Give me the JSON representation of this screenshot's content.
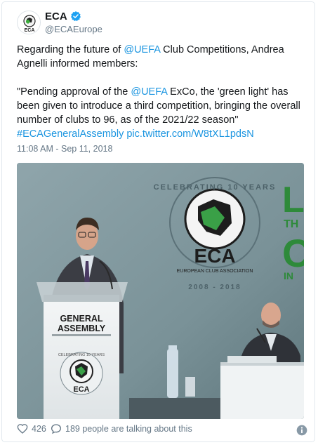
{
  "author": {
    "display_name": "ECA",
    "handle": "@ECAEurope",
    "avatar_label": "ECA"
  },
  "tweet": {
    "line1_pre": "Regarding the future of ",
    "line1_mention": "@UEFA",
    "line1_post": " Club Competitions, Andrea Agnelli informed members:",
    "quote_pre": "\"Pending approval of the ",
    "quote_mention": "@UEFA",
    "quote_post": " ExCo, the 'green light' has been given to introduce a third competition, bringing the overall number of clubs to 96, as of the 2021/22 season\"",
    "hashtag": "#ECAGeneralAssembly",
    "media_link": "pic.twitter.com/W8tXL1pdsN",
    "timestamp": "11:08 AM - Sep 11, 2018"
  },
  "photo": {
    "banner_arc": "CELEBRATING 10 YEARS",
    "banner_name": "ECA",
    "banner_sub": "EUROPEAN CLUB ASSOCIATION",
    "banner_years": "2008 - 2018",
    "podium_title1": "GENERAL",
    "podium_title2": "ASSEMBLY",
    "podium_arc": "CELEBRATING 10 YEARS",
    "podium_name": "ECA",
    "right_letters": "L\nTH\nC\nIN"
  },
  "engagement": {
    "likes": "426",
    "talking": "189 people are talking about this"
  },
  "colors": {
    "link": "#1b95e0",
    "muted": "#657786",
    "verified": "#1da1f2"
  },
  "icons": [
    "verified-badge-icon",
    "heart-icon",
    "comment-bubble-icon",
    "info-icon"
  ]
}
